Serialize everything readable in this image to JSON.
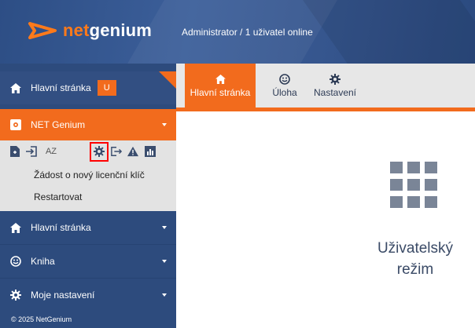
{
  "header": {
    "logo_prefix": "net",
    "logo_suffix": "genium",
    "user_status": "Administrator / 1 uživatel online"
  },
  "sidebar": {
    "home": {
      "label": "Hlavní stránka",
      "badge": "U"
    },
    "net_genium": {
      "label": "NET Genium"
    },
    "toolbar": {
      "sort_label": "AZ"
    },
    "links": [
      "Žádost o nový licenční klíč",
      "Restartovat"
    ],
    "items": [
      {
        "label": "Hlavní stránka",
        "icon": "home-icon"
      },
      {
        "label": "Kniha",
        "icon": "smiley-icon"
      },
      {
        "label": "Moje nastavení",
        "icon": "gear-icon"
      }
    ],
    "copyright": "© 2025 NetGenium"
  },
  "tabs": [
    {
      "label": "Hlavní stránka",
      "icon": "home-icon",
      "active": true
    },
    {
      "label": "Úloha",
      "icon": "smiley-icon",
      "active": false
    },
    {
      "label": "Nastavení",
      "icon": "gear-icon",
      "active": false
    }
  ],
  "main": {
    "mode_label_line1": "Uživatelský",
    "mode_label_line2": "režim"
  },
  "colors": {
    "accent": "#f26b1d",
    "sidebar": "#2d4b7d",
    "header": "#35558d",
    "highlight": "#ff0000"
  }
}
